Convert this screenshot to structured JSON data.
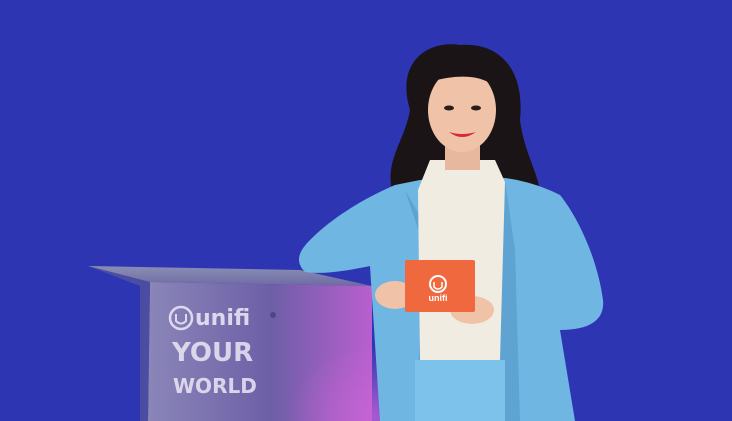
{
  "scene": {
    "background_color": "#2e35b3",
    "podium": {
      "brand_name": "unifi",
      "line_1": "YOUR",
      "line_2": "WORLD"
    },
    "card": {
      "brand_name": "unifi",
      "color": "#f0683e"
    },
    "subject_outfit_color": "#6fb6e3"
  }
}
